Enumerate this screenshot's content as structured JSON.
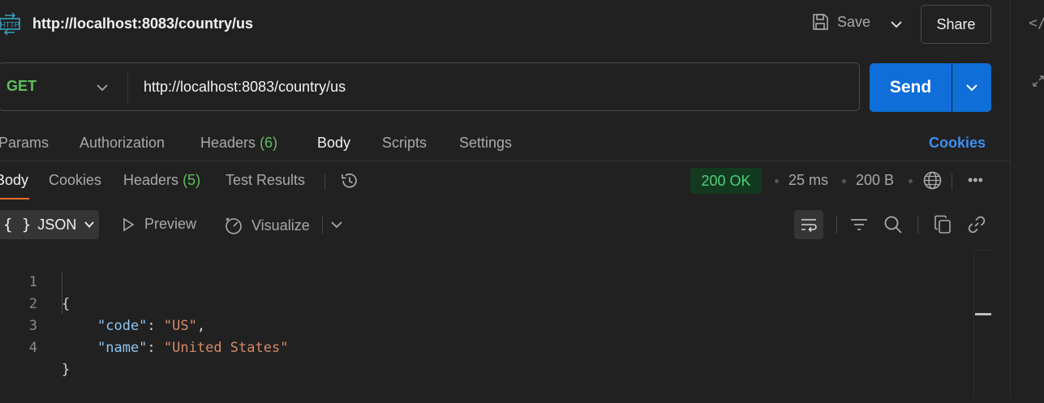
{
  "request": {
    "title": "http://localhost:8083/country/us",
    "method": "GET",
    "url": "http://localhost:8083/country/us",
    "save_label": "Save",
    "share_label": "Share",
    "send_label": "Send"
  },
  "request_tabs": {
    "params": "Params",
    "authorization": "Authorization",
    "headers": "Headers",
    "headers_count": "(6)",
    "body": "Body",
    "scripts": "Scripts",
    "settings": "Settings",
    "cookies": "Cookies"
  },
  "response_tabs": {
    "body": "Body",
    "cookies": "Cookies",
    "headers": "Headers",
    "headers_count": "(5)",
    "test_results": "Test Results"
  },
  "response_meta": {
    "status": "200 OK",
    "time": "25 ms",
    "size": "200 B",
    "more": "•••"
  },
  "view_options": {
    "format_brace": "{ }",
    "format": "JSON",
    "preview": "Preview",
    "visualize": "Visualize"
  },
  "side": {
    "code_icon": "</"
  },
  "editor": {
    "line_numbers": [
      "1",
      "2",
      "3",
      "4"
    ],
    "open_brace": "{",
    "close_brace": "}",
    "entries": [
      {
        "key": "\"code\"",
        "sep": ": ",
        "value": "\"US\"",
        "trail": ","
      },
      {
        "key": "\"name\"",
        "sep": ": ",
        "value": "\"United States\"",
        "trail": ""
      }
    ]
  },
  "colors": {
    "background": "#212121",
    "send_blue": "#0f6ed8",
    "method_green": "#5fbf5f",
    "status_green": "#4fd07a",
    "active_tab_underline": "#f36f2a",
    "cookies_link": "#3d8ff0",
    "json_key": "#8fc5f0",
    "json_string": "#d58a68"
  }
}
